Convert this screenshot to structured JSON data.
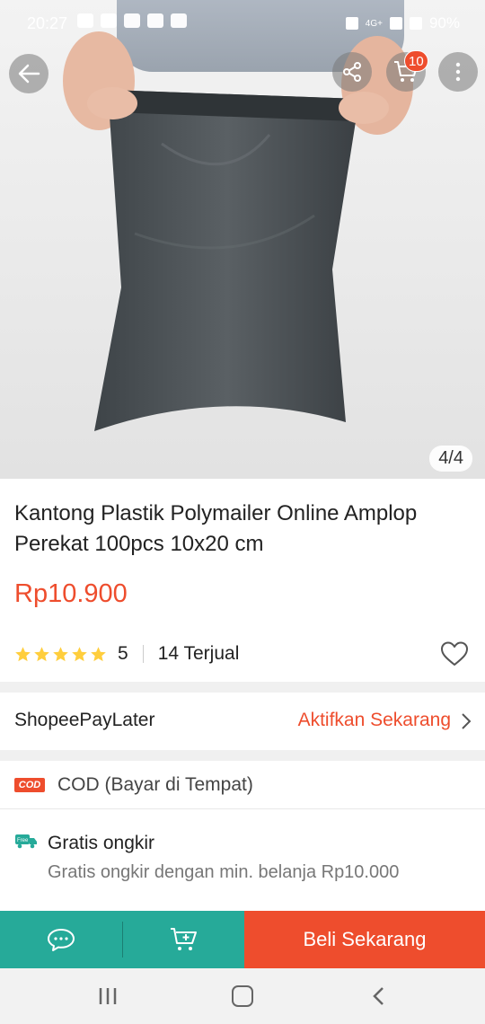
{
  "status_bar": {
    "time": "20:27",
    "network": "4G+",
    "battery": "90%"
  },
  "gallery": {
    "counter": "4/4"
  },
  "top_actions": {
    "cart_badge": "10"
  },
  "product": {
    "title": "Kantong Plastik Polymailer Online Amplop Perekat 100pcs 10x20 cm",
    "price": "Rp10.900",
    "rating": "5",
    "stars": 5,
    "sold": "14 Terjual"
  },
  "paylater": {
    "label": "ShopeePayLater",
    "action": "Aktifkan Sekarang"
  },
  "shipping": {
    "cod_logo": "COD",
    "cod_text": "COD (Bayar di Tempat)",
    "free_badge": "Free",
    "gratis_title": "Gratis ongkir",
    "gratis_subtitle": "Gratis ongkir dengan min. belanja Rp10.000"
  },
  "bottom_bar": {
    "buy_label": "Beli Sekarang"
  },
  "colors": {
    "accent": "#ee4d2d",
    "teal": "#26aa99",
    "star": "#ffce3d"
  }
}
